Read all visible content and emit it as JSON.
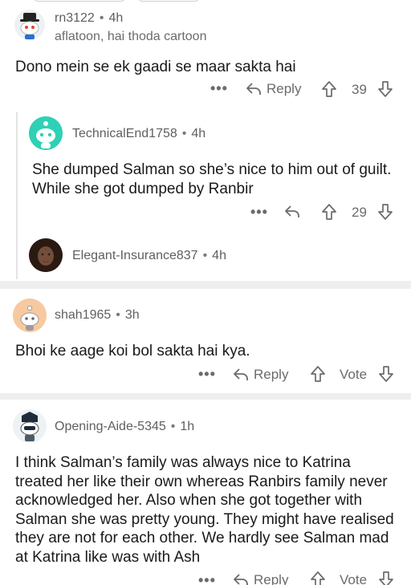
{
  "comments": [
    {
      "username": "rn3122",
      "age": "4h",
      "flair": "aflatoon, hai thoda cartoon",
      "body": "Dono mein se ek gaadi se maar sakta hai",
      "reply_label": "Reply",
      "votes": "39"
    },
    {
      "username": "TechnicalEnd1758",
      "age": "4h",
      "body": "She dumped Salman so she’s nice to him out of guilt. While she got dumped by Ranbir",
      "votes": "29"
    },
    {
      "username": "Elegant-Insurance837",
      "age": "4h"
    },
    {
      "username": "shah1965",
      "age": "3h",
      "body": "Bhoi ke aage koi bol sakta hai kya.",
      "reply_label": "Reply",
      "votes": "Vote"
    },
    {
      "username": "Opening-Aide-5345",
      "age": "1h",
      "body": "I think Salman’s family was always nice to Katrina treated her like their own whereas Ranbirs family never acknowledged her. Also when she got together with Salman she was pretty young. They might have realised they are not for each other. We hardly see Salman mad at Katrina like was with Ash",
      "reply_label": "Reply",
      "votes": "Vote"
    }
  ],
  "separator": "•",
  "more_glyph": "•••",
  "icons": {
    "reply": "reply-arrow-icon",
    "upvote": "upvote-arrow-icon",
    "downvote": "downvote-arrow-icon",
    "more": "more-options-icon"
  },
  "colors": {
    "text": "#1a1a1a",
    "meta": "#6b6b6b",
    "divider": "#eeeeee",
    "thread_line": "#e3e3e3",
    "avatar_teal": "#2ed1b5"
  }
}
